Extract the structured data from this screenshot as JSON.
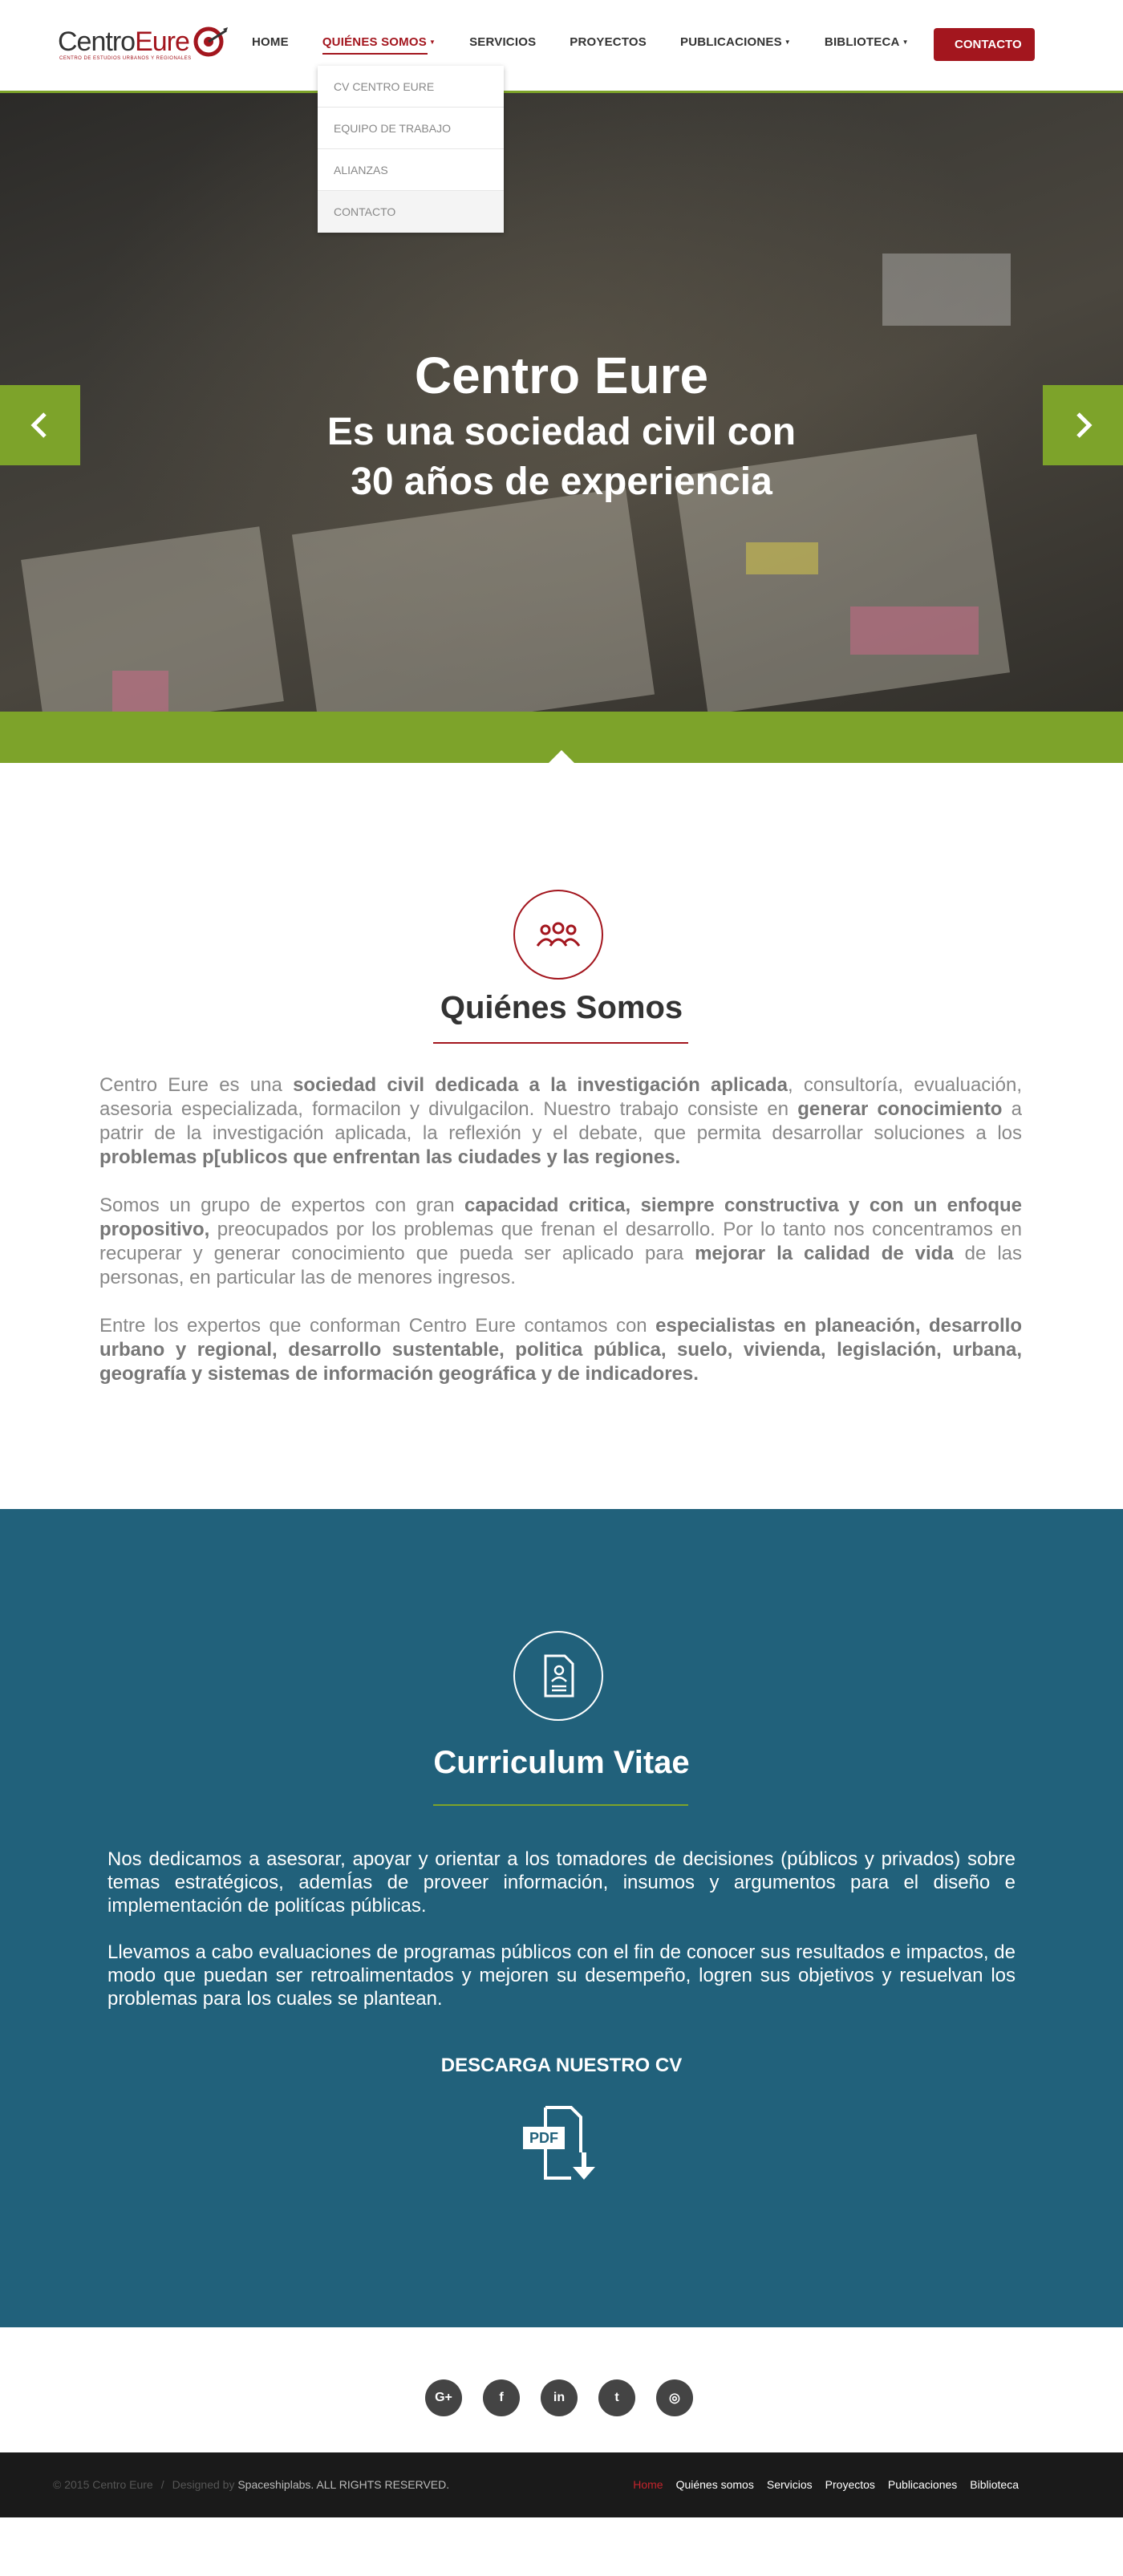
{
  "header": {
    "logo_part1": "Centro",
    "logo_part2": "Eure",
    "logo_tagline": "CENTRO DE ESTUDIOS URBANOS Y REGIONALES",
    "nav": [
      {
        "label": "HOME"
      },
      {
        "label": "QUIÉNES SOMOS",
        "active": true,
        "has_submenu": true
      },
      {
        "label": "SERVICIOS"
      },
      {
        "label": "PROYECTOS"
      },
      {
        "label": "PUBLICACIONES",
        "has_submenu": true
      },
      {
        "label": "BIBLIOTECA",
        "has_submenu": true
      }
    ],
    "contact_button": "CONTACTO",
    "dropdown": [
      "CV CENTRO EURE",
      "EQUIPO DE TRABAJO",
      "ALIANZAS",
      "CONTACTO"
    ]
  },
  "hero": {
    "title": "Centro Eure",
    "subtitle_line1": "Es una sociedad civil con",
    "subtitle_line2": "30 años de experiencia"
  },
  "about": {
    "title": "Quiénes Somos",
    "p1_a": "Centro Eure es una ",
    "p1_b": "sociedad civil dedicada a la investigación aplicada",
    "p1_c": ", consultoría, evualuación, asesoria especializada, formacilon y divulgacilon. Nuestro trabajo consiste en ",
    "p1_d": "generar conocimiento",
    "p1_e": " a patrir de la investigación aplicada, la reflexión y el debate, que permita desarrollar soluciones a los ",
    "p1_f": "problemas p[ublicos que enfrentan las ciudades y las regiones.",
    "p2_a": "Somos un grupo de expertos con gran ",
    "p2_b": "capacidad critica, siempre constructiva y con un enfoque propositivo,",
    "p2_c": " preocupados por los problemas que frenan el desarrollo. Por lo tanto nos concentramos en recuperar y generar conocimiento que pueda ser aplicado para ",
    "p2_d": "mejorar la calidad de vida",
    "p2_e": " de las personas, en particular las de menores ingresos.",
    "p3_a": "Entre los expertos que conforman Centro Eure contamos con ",
    "p3_b": "especialistas en planeación, desarrollo urbano y regional, desarrollo sustentable, politica pública, suelo, vivienda, legislación, urbana, geografía y sistemas de información geográfica y de indicadores."
  },
  "cv": {
    "title": "Curriculum Vitae",
    "p1": "Nos dedicamos a asesorar, apoyar y orientar a los tomadores de decisiones (públicos y privados) sobre temas estratégicos, ademÍas de proveer información, insumos y argumentos para el diseño e implementación de politícas públicas.",
    "p2": "Llevamos a cabo evaluaciones de programas públicos  con el fin de conocer sus resultados e impactos, de modo que puedan ser retroalimentados y mejoren su desempeño, logren sus objetivos y resuelvan los problemas para los cuales se plantean.",
    "download_label": "DESCARGA NUESTRO CV",
    "pdf_label": "PDF"
  },
  "social": {
    "icons": [
      "google-plus-icon",
      "facebook-icon",
      "linkedin-icon",
      "twitter-icon",
      "instagram-icon"
    ],
    "glyphs": [
      "G+",
      "f",
      "in",
      "t",
      "◎"
    ]
  },
  "footer": {
    "copyright": "© 2015 Centro Eure",
    "designed_by": "Designed by",
    "designer": "Spaceshiplabs.",
    "rights": "ALL RIGHTS RESERVED.",
    "nav": [
      "Home",
      "Quiénes somos",
      "Servicios",
      "Proyectos",
      "Publicaciones",
      "Biblioteca"
    ]
  },
  "colors": {
    "brand_red": "#a3161e",
    "brand_green": "#7da32a",
    "cv_blue": "#21617b",
    "footer_bg": "#1a1a1a"
  }
}
